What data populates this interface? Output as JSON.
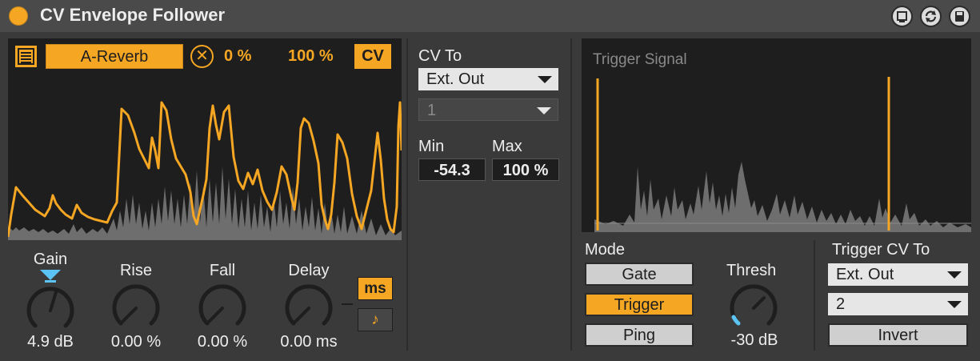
{
  "window": {
    "title": "CV Envelope Follower"
  },
  "input": {
    "source_label": "A-Reverb",
    "offset": "0 %",
    "depth": "100 %",
    "cv_label": "CV"
  },
  "knobs": [
    {
      "label": "Gain",
      "value": "4.9 dB"
    },
    {
      "label": "Rise",
      "value": "0.00 %"
    },
    {
      "label": "Fall",
      "value": "0.00 %"
    },
    {
      "label": "Delay",
      "value": "0.00 ms"
    }
  ],
  "delay_units": {
    "ms_label": "ms",
    "note_icon": "music-note-icon",
    "ms_active": true
  },
  "cv_out": {
    "label": "CV To",
    "target": "Ext. Out",
    "channel": "1",
    "min_label": "Min",
    "min_value": "-54.3",
    "max_label": "Max",
    "max_value": "100 %"
  },
  "trigger": {
    "scope_title": "Trigger Signal",
    "mode_label": "Mode",
    "modes": [
      "Gate",
      "Trigger",
      "Ping"
    ],
    "active_mode": "Trigger",
    "thresh_label": "Thresh",
    "thresh_value": "-30 dB",
    "cv_to_label": "Trigger CV To",
    "cv_to_target": "Ext. Out",
    "cv_to_channel": "2",
    "invert_label": "Invert"
  },
  "colors": {
    "accent": "#f5a623",
    "knob_marker": "#5bc4f5",
    "scope_bg": "#1e1e1e"
  }
}
